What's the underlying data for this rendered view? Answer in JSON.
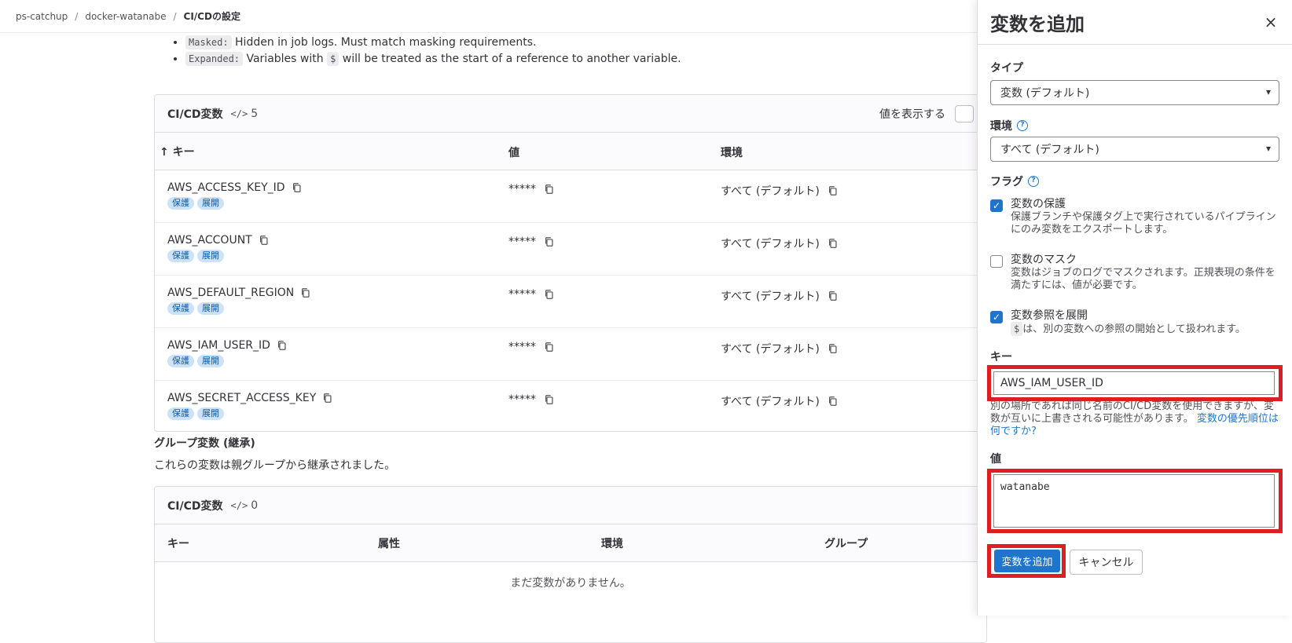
{
  "breadcrumb": [
    "ps-catchup",
    "docker-watanabe",
    "CI/CDの設定"
  ],
  "legend": [
    {
      "tag": "Masked:",
      "text": "Hidden in job logs. Must match masking requirements."
    },
    {
      "tag": "Expanded:",
      "text_before": "Variables with",
      "code": "$",
      "text_after": "will be treated as the start of a reference to another variable."
    }
  ],
  "project_vars": {
    "title": "CI/CD変数",
    "count": "5",
    "reveal_label": "値を表示する",
    "headers": {
      "key": "↑ キー",
      "value": "値",
      "env": "環境"
    },
    "rows": [
      {
        "key": "AWS_ACCESS_KEY_ID",
        "value": "*****",
        "env": "すべて (デフォルト)",
        "badges": [
          "保護",
          "展開"
        ]
      },
      {
        "key": "AWS_ACCOUNT",
        "value": "*****",
        "env": "すべて (デフォルト)",
        "badges": [
          "保護",
          "展開"
        ]
      },
      {
        "key": "AWS_DEFAULT_REGION",
        "value": "*****",
        "env": "すべて (デフォルト)",
        "badges": [
          "保護",
          "展開"
        ]
      },
      {
        "key": "AWS_IAM_USER_ID",
        "value": "*****",
        "env": "すべて (デフォルト)",
        "badges": [
          "保護",
          "展開"
        ]
      },
      {
        "key": "AWS_SECRET_ACCESS_KEY",
        "value": "*****",
        "env": "すべて (デフォルト)",
        "badges": [
          "保護",
          "展開"
        ]
      }
    ]
  },
  "group_section": {
    "title": "グループ変数 (継承)",
    "desc": "これらの変数は親グループから継承されました。"
  },
  "group_vars": {
    "title": "CI/CD変数",
    "count": "0",
    "headers": {
      "key": "キー",
      "attr": "属性",
      "env": "環境",
      "group": "グループ"
    },
    "empty": "まだ変数がありません。"
  },
  "drawer": {
    "title": "変数を追加",
    "close": "×",
    "type_label": "タイプ",
    "type_value": "変数 (デフォルト)",
    "env_label": "環境",
    "env_value": "すべて (デフォルト)",
    "flags_label": "フラグ",
    "protect": {
      "title": "変数の保護",
      "help": "保護ブランチや保護タグ上で実行されているパイプラインにのみ変数をエクスポートします。",
      "checked": true
    },
    "mask": {
      "title": "変数のマスク",
      "help": "変数はジョブのログでマスクされます。正規表現の条件を満たすには、値が必要です。",
      "checked": false
    },
    "expand": {
      "title": "変数参照を展開",
      "code": "$",
      "help": "は、別の変数への参照の開始として扱われます。",
      "checked": true
    },
    "key_label": "キー",
    "key_value": "AWS_IAM_USER_ID",
    "key_help": "別の場所であれば同じ名前のCI/CD変数を使用できますが、変数が互いに上書きされる可能性があります。",
    "key_help_link": "変数の優先順位は何ですか?",
    "value_label": "値",
    "value_value": "watanabe",
    "submit": "変数を追加",
    "cancel": "キャンセル"
  },
  "colors": {
    "accent": "#1f75cb",
    "highlight": "#dd1e22",
    "badge_bg": "#cbe2f9"
  }
}
